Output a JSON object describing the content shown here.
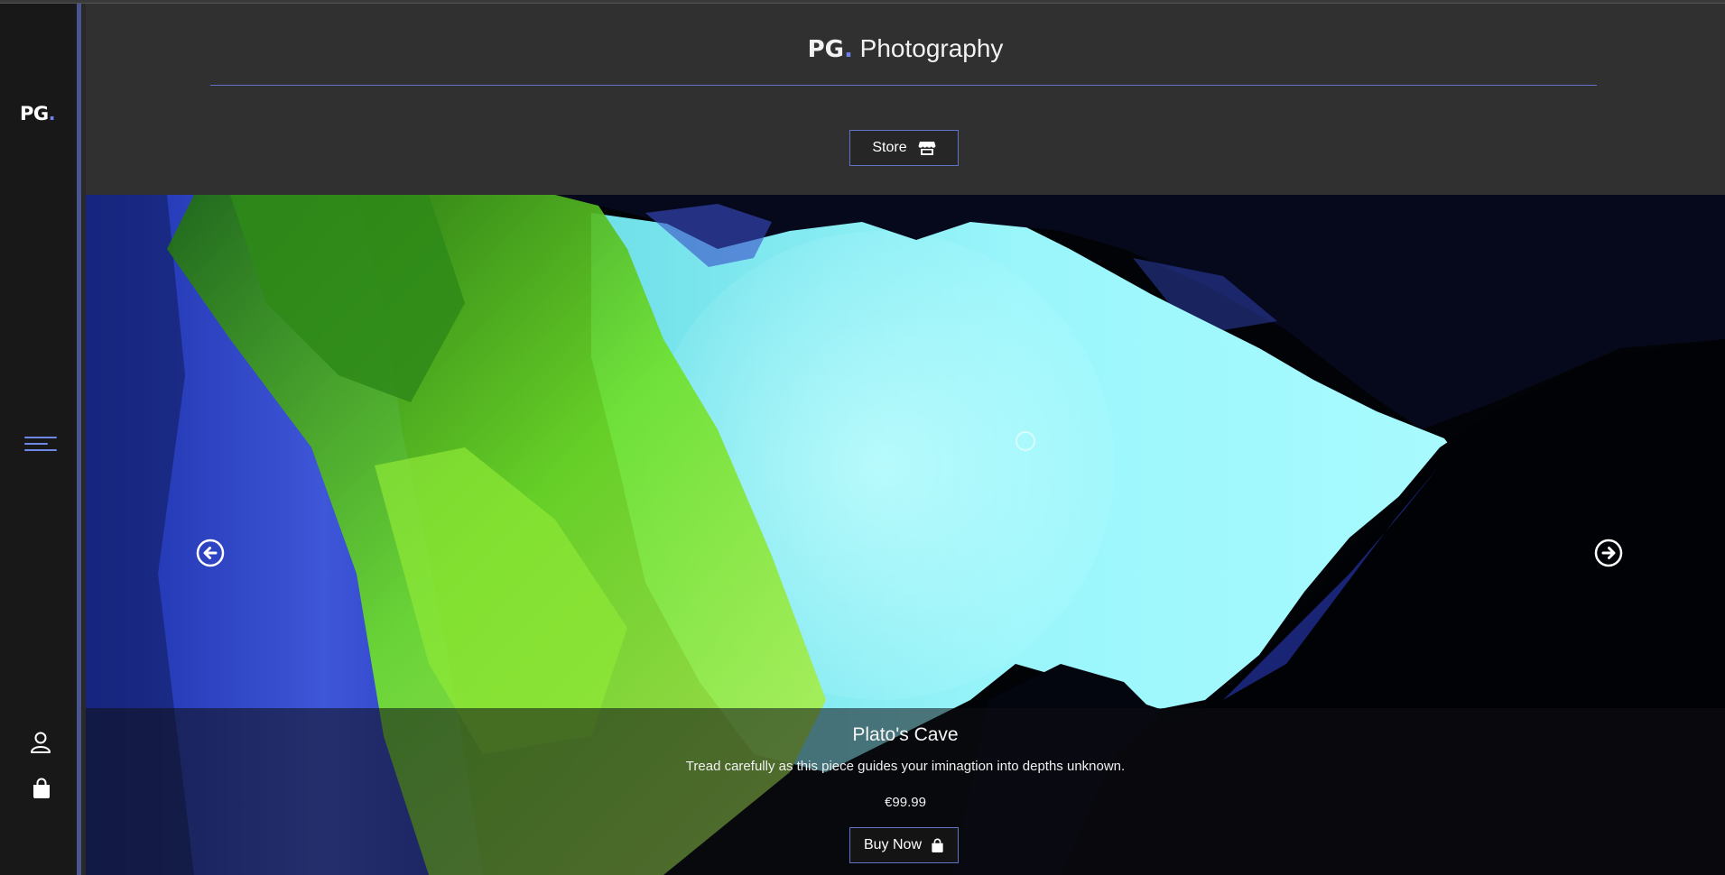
{
  "sidebar": {
    "logo_text": "PG",
    "logo_dot": ".",
    "menu_icon": "hamburger-icon",
    "account_icon": "user-icon",
    "cart_icon": "shopping-bag-icon"
  },
  "header": {
    "brand": "PG",
    "brand_dot": ".",
    "title": "Photography",
    "store_label": "Store",
    "store_icon": "store-icon"
  },
  "carousel": {
    "prev_icon": "arrow-left-circle-icon",
    "next_icon": "arrow-right-circle-icon",
    "item": {
      "title": "Plato's Cave",
      "description": "Tread carefully as this piece guides your iminagtion into depths unknown.",
      "price": "€99.99",
      "buy_label": "Buy Now",
      "buy_icon": "shopping-bag-icon"
    }
  },
  "colors": {
    "accent": "#6272c9",
    "sidebar_bg": "#181818",
    "header_bg": "#303030"
  }
}
